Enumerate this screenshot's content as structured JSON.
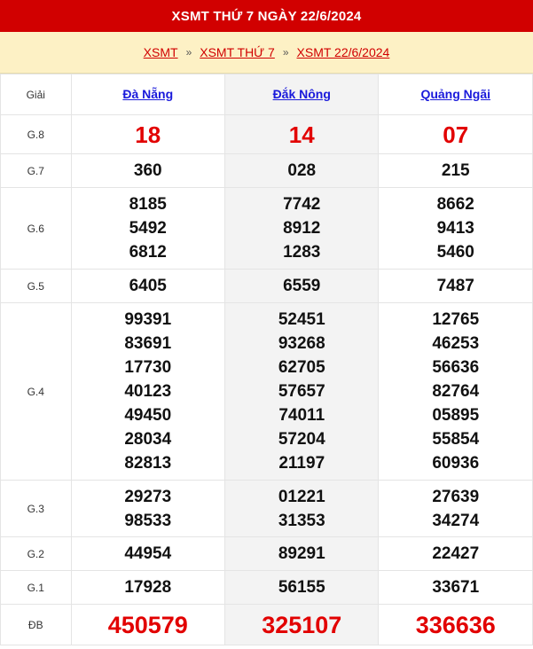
{
  "header": {
    "title": "XSMT THỨ 7 NGÀY 22/6/2024"
  },
  "breadcrumb": {
    "items": [
      "XSMT",
      "XSMT THỨ 7",
      "XSMT 22/6/2024"
    ],
    "separator": "»"
  },
  "table": {
    "label_header": "Giải",
    "provinces": [
      "Đà Nẵng",
      "Đắk Nông",
      "Quảng Ngãi"
    ],
    "rows": [
      {
        "label": "G.8",
        "values": [
          [
            "18"
          ],
          [
            "14"
          ],
          [
            "07"
          ]
        ]
      },
      {
        "label": "G.7",
        "values": [
          [
            "360"
          ],
          [
            "028"
          ],
          [
            "215"
          ]
        ]
      },
      {
        "label": "G.6",
        "values": [
          [
            "8185",
            "5492",
            "6812"
          ],
          [
            "7742",
            "8912",
            "1283"
          ],
          [
            "8662",
            "9413",
            "5460"
          ]
        ]
      },
      {
        "label": "G.5",
        "values": [
          [
            "6405"
          ],
          [
            "6559"
          ],
          [
            "7487"
          ]
        ]
      },
      {
        "label": "G.4",
        "values": [
          [
            "99391",
            "83691",
            "17730",
            "40123",
            "49450",
            "28034",
            "82813"
          ],
          [
            "52451",
            "93268",
            "62705",
            "57657",
            "74011",
            "57204",
            "21197"
          ],
          [
            "12765",
            "46253",
            "56636",
            "82764",
            "05895",
            "55854",
            "60936"
          ]
        ]
      },
      {
        "label": "G.3",
        "values": [
          [
            "29273",
            "98533"
          ],
          [
            "01221",
            "31353"
          ],
          [
            "27639",
            "34274"
          ]
        ]
      },
      {
        "label": "G.2",
        "values": [
          [
            "44954"
          ],
          [
            "89291"
          ],
          [
            "22427"
          ]
        ]
      },
      {
        "label": "G.1",
        "values": [
          [
            "17928"
          ],
          [
            "56155"
          ],
          [
            "33671"
          ]
        ]
      },
      {
        "label": "ĐB",
        "values": [
          [
            "450579"
          ],
          [
            "325107"
          ],
          [
            "336636"
          ]
        ]
      }
    ]
  },
  "colors": {
    "brand_red": "#d10000",
    "number_red": "#e20000",
    "link_blue": "#1a1adb",
    "breadcrumb_bg": "#fdf1c5"
  }
}
